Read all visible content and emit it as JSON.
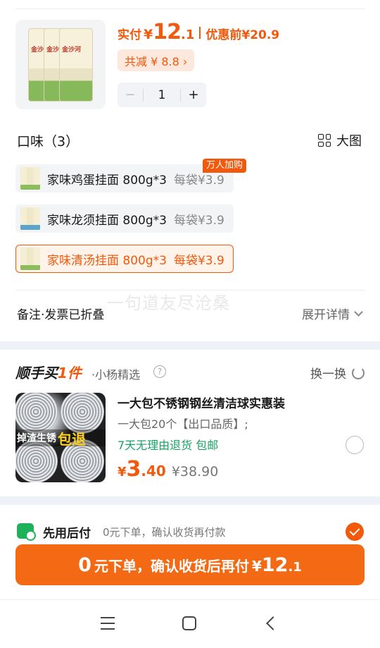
{
  "product": {
    "price_label": "实付",
    "currency": "¥",
    "price_int": "12",
    "price_dec": ".1",
    "before_label": "优惠前",
    "before_price": "¥20.9",
    "discount_text": "共减 ¥ 8.8 ›",
    "quantity": "1",
    "minus": "−",
    "plus": "+",
    "pack_text": "金沙河"
  },
  "flavor": {
    "title": "口味（3）",
    "big_view": "大图",
    "hot_badge": "万人加购",
    "options": [
      {
        "name": "家味鸡蛋挂面 800g*3",
        "each": "每袋¥3.9",
        "selected": false
      },
      {
        "name": "家味龙须挂面 800g*3",
        "each": "每袋¥3.9",
        "selected": false
      },
      {
        "name": "家味清汤挂面 800g*3",
        "each": "每袋¥3.9",
        "selected": true
      }
    ]
  },
  "watermark": "一句道友尽沧桑",
  "notes": {
    "label": "备注·发票已折叠",
    "expand": "展开详情"
  },
  "shunshou": {
    "brand_a": "顺手买",
    "brand_b": "1件",
    "sub": "·小杨精选",
    "help": "?",
    "swap": "换一换",
    "image_tag_a": "掉渣生锈",
    "image_tag_b": "包退",
    "title": "一大包不锈钢钢丝清洁球实惠装",
    "desc": "一大包20个【出口品质】;",
    "returns": "7天无理由退货  包邮",
    "currency": "¥",
    "price_int": "3",
    "price_dec": ".40",
    "orig": "¥38.90"
  },
  "pay": {
    "title": "先用后付",
    "sub": "0元下单，确认收货再付款"
  },
  "cta": {
    "zero": "0",
    "text": "元下单，确认收货后再付",
    "currency": "¥",
    "int": "12",
    "dec": ".1"
  },
  "colors": {
    "accent": "#f2590c",
    "cta": "#f46a14",
    "green": "#1aa06a"
  }
}
